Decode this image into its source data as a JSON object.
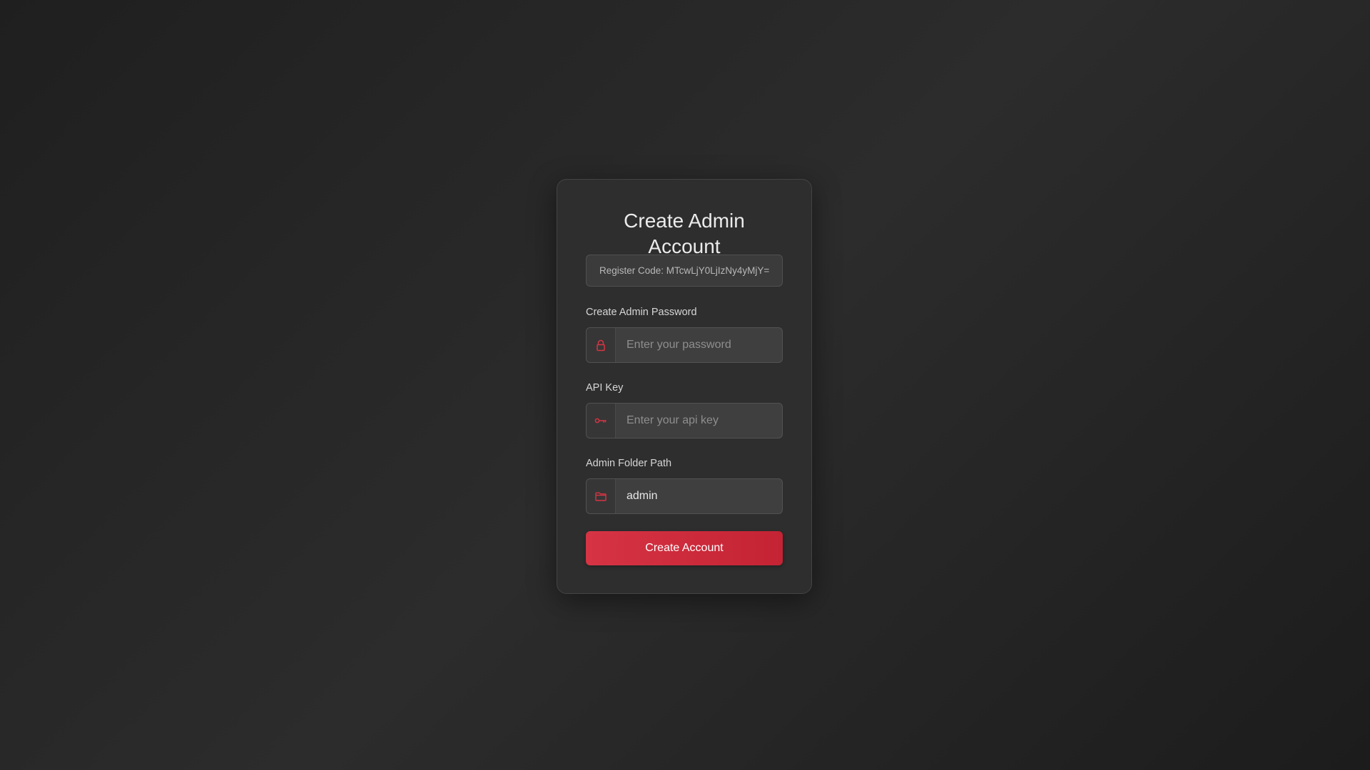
{
  "form": {
    "title": "Create Admin Account",
    "register_code": "Register Code: MTcwLjY0LjIzNy4yMjY=",
    "password": {
      "label": "Create Admin Password",
      "placeholder": "Enter your password",
      "value": "",
      "icon": "lock-icon"
    },
    "api_key": {
      "label": "API Key",
      "placeholder": "Enter your api key",
      "value": "",
      "icon": "key-icon"
    },
    "folder_path": {
      "label": "Admin Folder Path",
      "placeholder": "",
      "value": "admin",
      "icon": "folder-icon"
    },
    "submit_label": "Create Account"
  },
  "colors": {
    "accent": "#d63444",
    "card_background": "#2e2e2e",
    "page_background": "#262626"
  }
}
